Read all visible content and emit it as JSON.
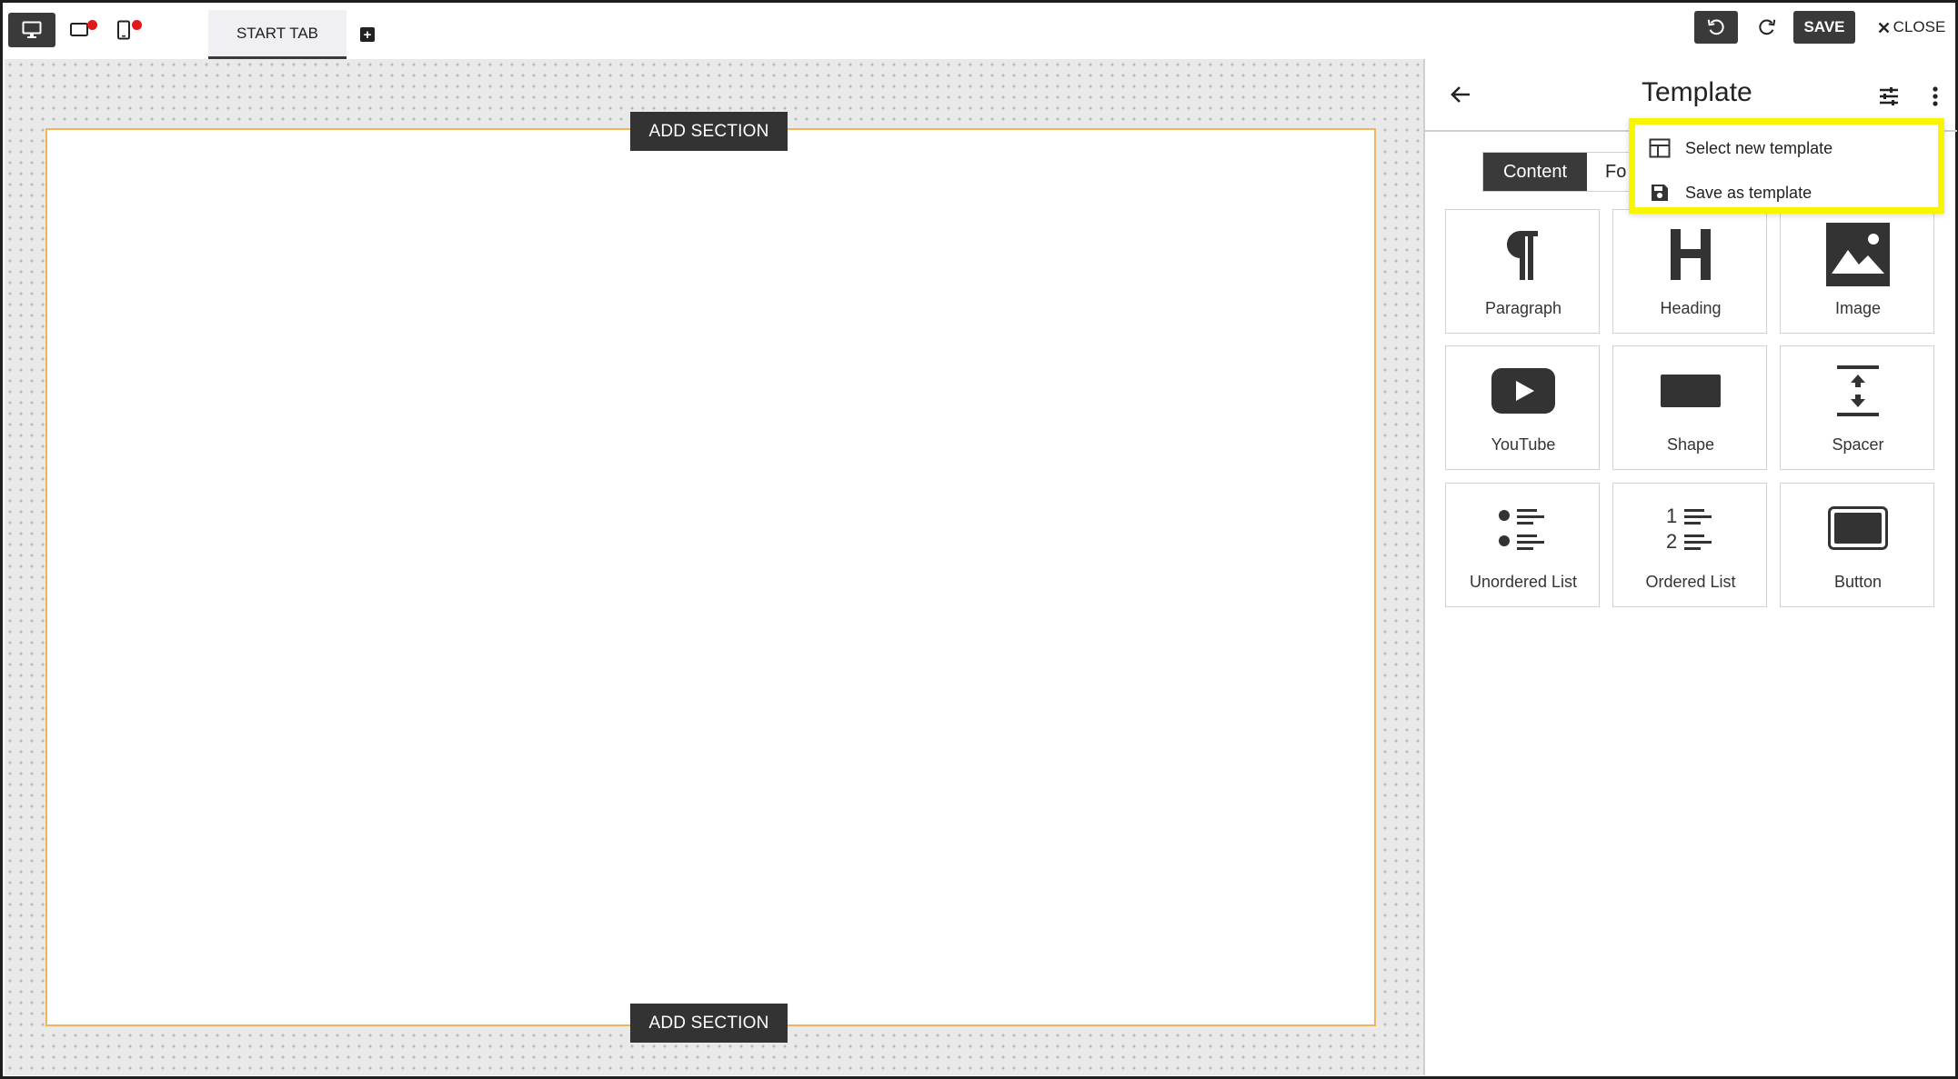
{
  "topbar": {
    "devices": [
      {
        "icon": "desktop-icon",
        "active": true,
        "has_dot": false
      },
      {
        "icon": "tablet-icon",
        "active": false,
        "has_dot": true
      },
      {
        "icon": "mobile-icon",
        "active": false,
        "has_dot": true
      }
    ],
    "tab_label": "START TAB",
    "add_tab_icon": "plus-square-icon",
    "undo_icon": "undo-icon",
    "redo_icon": "redo-icon",
    "save_label": "SAVE",
    "close_label": "CLOSE",
    "close_icon": "close-icon"
  },
  "canvas": {
    "add_section_top": "ADD SECTION",
    "add_section_bottom": "ADD SECTION",
    "section_border_color": "#f0b45e"
  },
  "panel": {
    "title": "Template",
    "tabs": [
      {
        "label": "Content",
        "active": true
      },
      {
        "label": "Fo",
        "active": false
      }
    ],
    "elements": [
      {
        "label": "Paragraph",
        "icon": "paragraph-icon"
      },
      {
        "label": "Heading",
        "icon": "heading-icon"
      },
      {
        "label": "Image",
        "icon": "image-icon"
      },
      {
        "label": "YouTube",
        "icon": "youtube-icon"
      },
      {
        "label": "Shape",
        "icon": "shape-icon"
      },
      {
        "label": "Spacer",
        "icon": "spacer-icon"
      },
      {
        "label": "Unordered List",
        "icon": "unordered-list-icon"
      },
      {
        "label": "Ordered List",
        "icon": "ordered-list-icon"
      },
      {
        "label": "Button",
        "icon": "button-icon"
      }
    ]
  },
  "menu": {
    "highlight_color": "#f7f500",
    "items": [
      {
        "label": "Select new template",
        "icon": "template-grid-icon"
      },
      {
        "label": "Save as template",
        "icon": "floppy-disk-icon"
      }
    ]
  },
  "colors": {
    "dark": "#3a3a3a",
    "notification_dot": "#e01818"
  }
}
